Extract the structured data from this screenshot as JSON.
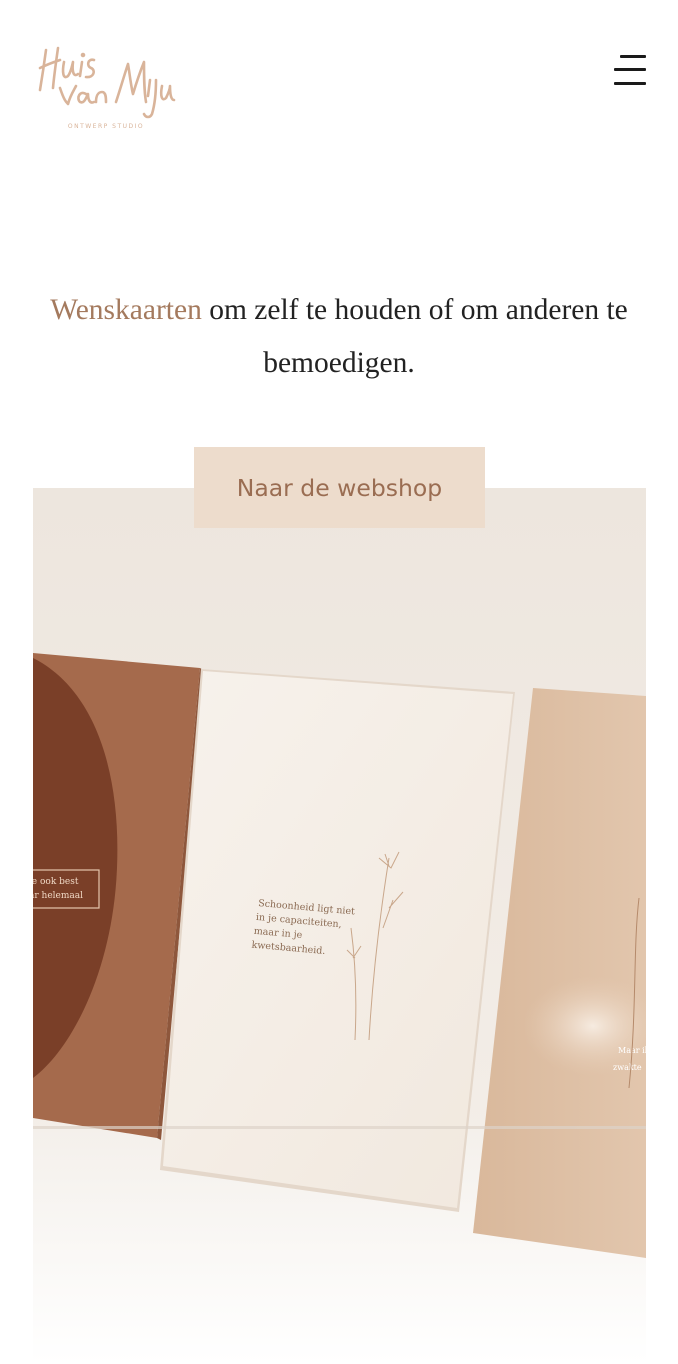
{
  "header": {
    "logo_icon": "huis-van-mijn-handwritten-logo",
    "logo_text": "Huis van Mijn",
    "logo_subtext": "ONTWERP STUDIO",
    "menu_icon": "hamburger-menu-icon"
  },
  "intro": {
    "highlight": "Wenskaarten",
    "rest": " om zelf te houden of om anderen te bemoedigen."
  },
  "cta": {
    "label": "Naar de webshop"
  },
  "hero": {
    "card_quote_left": "je ook best\nar helemaal",
    "card_quote_center": "Schoonheid ligt niet\nin je capaciteiten,\nmaar in je\nkwetsbaarheid.",
    "card_quote_right": "Maar ik\nzwakte"
  },
  "colors": {
    "accent": "#a47a5e",
    "cta_bg": "#eddccc",
    "cta_text": "#9a6d52",
    "logo": "#d9b49a"
  }
}
